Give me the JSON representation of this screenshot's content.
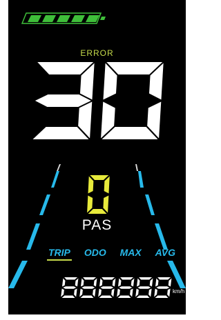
{
  "display": {
    "battery": {
      "level_percent": 100,
      "segments_total": 5,
      "segments_filled": 5,
      "color": "#3fbf3a"
    },
    "error_label": "ERROR",
    "speed": {
      "value": "30",
      "color": "#ffffff"
    },
    "assist": {
      "value": "0",
      "label": "PAS",
      "color": "#e7ea3b"
    },
    "modes": [
      {
        "label": "TRIP",
        "active": true
      },
      {
        "label": "ODO",
        "active": false
      },
      {
        "label": "MAX",
        "active": false
      },
      {
        "label": "AVG",
        "active": false
      }
    ],
    "odometer": {
      "digits": "888888",
      "unit": "km/h"
    },
    "colors": {
      "background": "#000000",
      "accent_cyan": "#27b9ea",
      "accent_yellow": "#c7dc4b"
    }
  }
}
